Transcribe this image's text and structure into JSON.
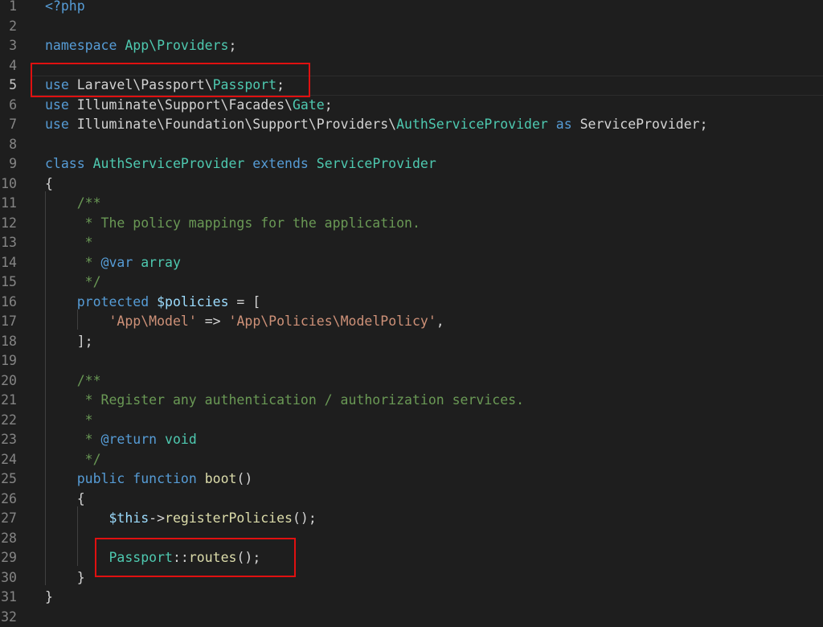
{
  "editor": {
    "active_line": 5,
    "colors": {
      "background": "#1e1e1e",
      "keyword": "#569cd6",
      "class": "#4ec9b0",
      "variable": "#9cdcfe",
      "string": "#ce9178",
      "comment": "#6a9955",
      "function": "#dcdcaa",
      "highlight_box": "#e01010"
    },
    "lines": [
      [
        [
          "<?php",
          "kw"
        ]
      ],
      [],
      [
        [
          "namespace",
          "kw"
        ],
        [
          " ",
          "pl"
        ],
        [
          "App\\Providers",
          "cls"
        ],
        [
          ";",
          "pl"
        ]
      ],
      [],
      [
        [
          "use",
          "kw"
        ],
        [
          " Laravel\\Passport\\",
          "pl"
        ],
        [
          "Passport",
          "cls"
        ],
        [
          ";",
          "pl"
        ]
      ],
      [
        [
          "use",
          "kw"
        ],
        [
          " Illuminate\\Support\\Facades\\",
          "pl"
        ],
        [
          "Gate",
          "cls"
        ],
        [
          ";",
          "pl"
        ]
      ],
      [
        [
          "use",
          "kw"
        ],
        [
          " Illuminate\\Foundation\\Support\\Providers\\",
          "pl"
        ],
        [
          "AuthServiceProvider",
          "cls"
        ],
        [
          " ",
          "pl"
        ],
        [
          "as",
          "kw"
        ],
        [
          " ServiceProvider;",
          "pl"
        ]
      ],
      [],
      [
        [
          "class",
          "kw"
        ],
        [
          " ",
          "pl"
        ],
        [
          "AuthServiceProvider",
          "cls"
        ],
        [
          " ",
          "pl"
        ],
        [
          "extends",
          "kw"
        ],
        [
          " ",
          "pl"
        ],
        [
          "ServiceProvider",
          "cls"
        ]
      ],
      [
        [
          "{",
          "pl"
        ]
      ],
      [
        [
          "    /**",
          "com"
        ]
      ],
      [
        [
          "     * The policy mappings for the application.",
          "com"
        ]
      ],
      [
        [
          "     *",
          "com"
        ]
      ],
      [
        [
          "     * ",
          "com"
        ],
        [
          "@var",
          "kw"
        ],
        [
          " ",
          "com"
        ],
        [
          "array",
          "cls"
        ]
      ],
      [
        [
          "     */",
          "com"
        ]
      ],
      [
        [
          "    ",
          "pl"
        ],
        [
          "protected",
          "kw"
        ],
        [
          " ",
          "pl"
        ],
        [
          "$policies",
          "var"
        ],
        [
          " = [",
          "pl"
        ]
      ],
      [
        [
          "        ",
          "pl"
        ],
        [
          "'App\\Model'",
          "str"
        ],
        [
          " => ",
          "pl"
        ],
        [
          "'App\\Policies\\ModelPolicy'",
          "str"
        ],
        [
          ",",
          "pl"
        ]
      ],
      [
        [
          "    ];",
          "pl"
        ]
      ],
      [],
      [
        [
          "    /**",
          "com"
        ]
      ],
      [
        [
          "     * Register any authentication / authorization services.",
          "com"
        ]
      ],
      [
        [
          "     *",
          "com"
        ]
      ],
      [
        [
          "     * ",
          "com"
        ],
        [
          "@return",
          "kw"
        ],
        [
          " ",
          "com"
        ],
        [
          "void",
          "cls"
        ]
      ],
      [
        [
          "     */",
          "com"
        ]
      ],
      [
        [
          "    ",
          "pl"
        ],
        [
          "public",
          "kw"
        ],
        [
          " ",
          "pl"
        ],
        [
          "function",
          "kw"
        ],
        [
          " ",
          "pl"
        ],
        [
          "boot",
          "fn"
        ],
        [
          "()",
          "pl"
        ]
      ],
      [
        [
          "    {",
          "pl"
        ]
      ],
      [
        [
          "        ",
          "pl"
        ],
        [
          "$this",
          "var"
        ],
        [
          "->",
          "pl"
        ],
        [
          "registerPolicies",
          "fn"
        ],
        [
          "();",
          "pl"
        ]
      ],
      [],
      [
        [
          "        ",
          "pl"
        ],
        [
          "Passport",
          "cls"
        ],
        [
          "::",
          "pl"
        ],
        [
          "routes",
          "fn"
        ],
        [
          "();",
          "pl"
        ]
      ],
      [
        [
          "    }",
          "pl"
        ]
      ],
      [
        [
          "}",
          "pl"
        ]
      ],
      []
    ]
  }
}
